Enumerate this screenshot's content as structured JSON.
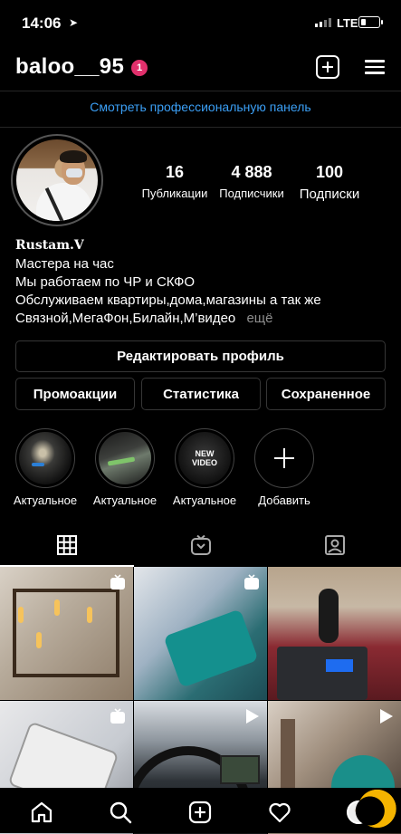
{
  "status": {
    "time": "14:06",
    "network": "LTE"
  },
  "header": {
    "username": "baloo__95",
    "notification_count": "1"
  },
  "pro_dashboard": "Смотреть профессиональную панель",
  "stats": [
    {
      "value": "16",
      "label": "Публикации"
    },
    {
      "value": "4 888",
      "label": "Подписчики"
    },
    {
      "value": "100",
      "label": "Подписки"
    }
  ],
  "bio": {
    "name": "Rustam.V",
    "lines": [
      "Мастера на час",
      "Мы работаем по ЧР и СКФО",
      "Обслуживаем квартиры,дома,магазины а так же",
      "Связной,МегаФон,Билайн,М’видео"
    ],
    "more": "ещё"
  },
  "buttons": {
    "edit_profile": "Редактировать профиль",
    "promotions": "Промоакции",
    "statistics": "Статистика",
    "saved": "Сохраненное"
  },
  "highlights": [
    {
      "label": "Актуальное"
    },
    {
      "label": "Актуальное"
    },
    {
      "label": "Актуальное",
      "cover_text": "NEW VIDEO"
    },
    {
      "label": "Добавить"
    }
  ],
  "tabs": [
    "grid-icon",
    "igtv-icon",
    "tagged-icon"
  ],
  "nav": [
    "home-icon",
    "search-icon",
    "new-post-icon",
    "activity-icon",
    "profile-icon"
  ],
  "colors": {
    "accent_link": "#3b9ff5",
    "badge": "#e1306c",
    "border": "#363636",
    "muted": "#8e8e8e"
  }
}
